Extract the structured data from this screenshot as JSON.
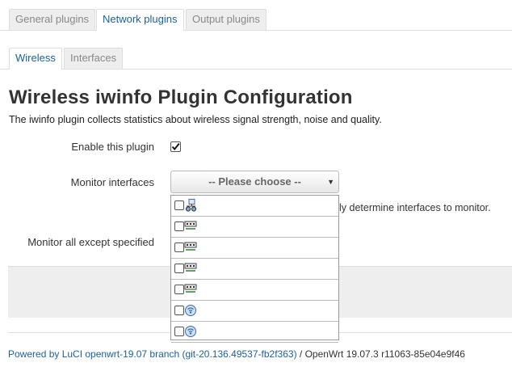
{
  "main_tabs": [
    "General plugins",
    "Network plugins",
    "Output plugins"
  ],
  "sub_tabs": [
    "Wireless",
    "Interfaces"
  ],
  "page": {
    "title": "Wireless iwinfo Plugin Configuration",
    "description": "The iwinfo plugin collects statistics about wireless signal strength, noise and quality."
  },
  "form": {
    "enable_label": "Enable this plugin",
    "enable_checked": true,
    "monitor_label": "Monitor interfaces",
    "select_placeholder": "-- Please choose --",
    "help_text": "ly determine interfaces to monitor.",
    "except_label": "Monitor all except specified"
  },
  "dropdown": {
    "items": [
      {
        "icon": "bridge-icon"
      },
      {
        "icon": "ethernet-icon"
      },
      {
        "icon": "ethernet-icon"
      },
      {
        "icon": "ethernet-icon"
      },
      {
        "icon": "ethernet-icon"
      },
      {
        "icon": "wifi-icon"
      },
      {
        "icon": "wifi-icon"
      }
    ]
  },
  "footer": {
    "link_text": "Powered by LuCI openwrt-19.07 branch (git-20.136.49537-fb2f363)",
    "version_text": " / OpenWrt 19.07.3 r11063-85e04e9f46"
  },
  "colors": {
    "accent": "#1e5f99",
    "tab_bg": "#eeeeee",
    "border": "#dddddd"
  }
}
